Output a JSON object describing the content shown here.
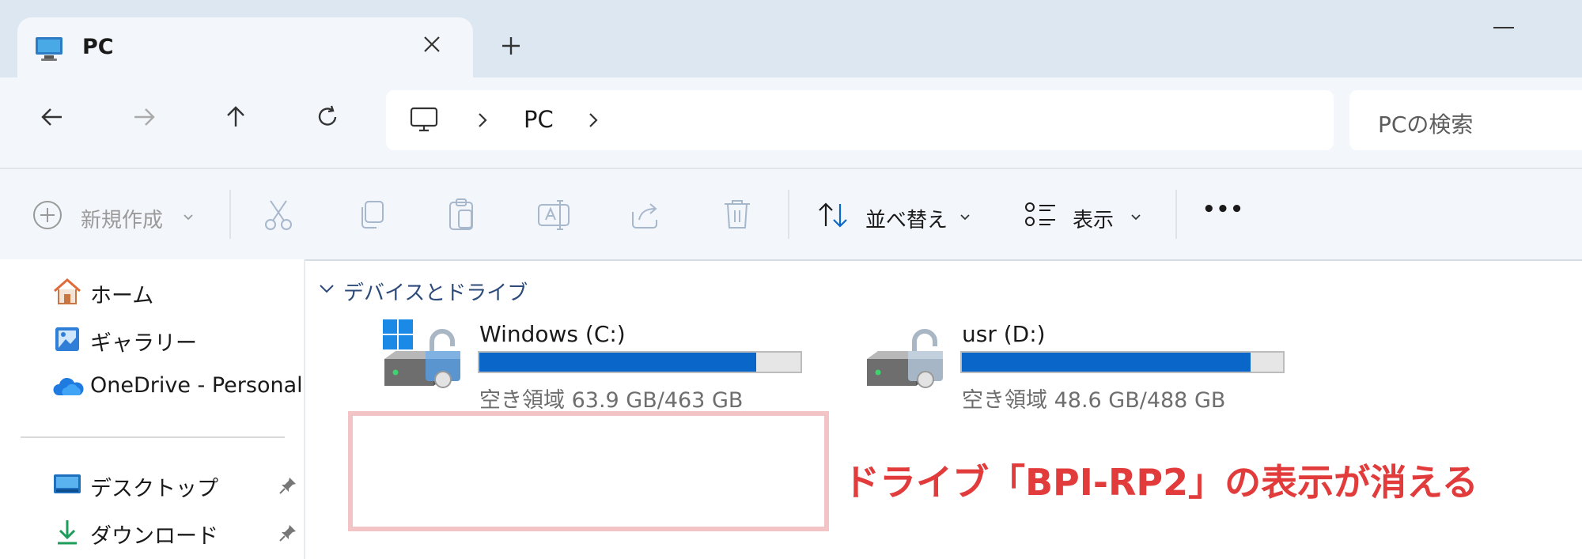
{
  "window": {
    "tab_title": "PC",
    "new_tab_symbol": "+"
  },
  "address": {
    "segments": [
      "PC"
    ]
  },
  "search": {
    "placeholder": "PCの検索"
  },
  "toolbar": {
    "new_label": "新規作成",
    "sort_label": "並べ替え",
    "view_label": "表示",
    "more_label": "•••"
  },
  "sidebar": {
    "items": [
      {
        "label": "ホーム",
        "icon": "home-icon"
      },
      {
        "label": "ギャラリー",
        "icon": "gallery-icon"
      },
      {
        "label": "OneDrive - Personal",
        "icon": "onedrive-icon"
      },
      {
        "label": "デスクトップ",
        "icon": "desktop-folder-icon",
        "pinned": true
      },
      {
        "label": "ダウンロード",
        "icon": "download-icon",
        "pinned": true
      }
    ]
  },
  "main": {
    "group_label": "デバイスとドライブ",
    "drives": [
      {
        "name": "Windows (C:)",
        "free_text": "空き領域 63.9 GB/463 GB",
        "used_fraction": 0.862,
        "icon": "windows-drive-icon"
      },
      {
        "name": "usr (D:)",
        "free_text": "空き領域 48.6 GB/488 GB",
        "used_fraction": 0.9,
        "icon": "drive-icon"
      }
    ]
  },
  "annotation": {
    "text": "ドライブ「BPI-RP2」の表示が消える",
    "color": "#e23b3b"
  },
  "colors": {
    "accent": "#0a67c9",
    "titlebar": "#dce7f2",
    "toolbar_bg": "#f3f6fa"
  }
}
